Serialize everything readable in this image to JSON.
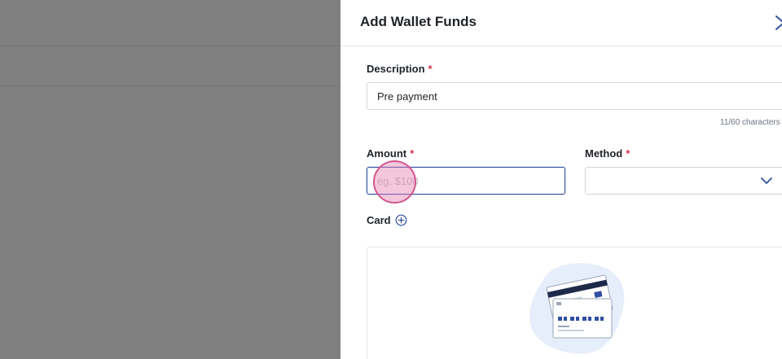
{
  "drawer": {
    "title": "Add Wallet Funds"
  },
  "form": {
    "description": {
      "label": "Description",
      "required_mark": "*",
      "value": "Pre payment",
      "char_count": "11/60 characters"
    },
    "amount": {
      "label": "Amount",
      "required_mark": "*",
      "placeholder": "eg. $100",
      "value": ""
    },
    "method": {
      "label": "Method",
      "required_mark": "*",
      "selected": ""
    },
    "card": {
      "label": "Card"
    }
  },
  "icons": {
    "close": "close-icon",
    "chevron": "chevron-down-icon",
    "add": "plus-circle-icon",
    "empty_state": "cards-illustration"
  },
  "colors": {
    "accent": "#2f4fa0",
    "required": "#d6334e",
    "overlay": "#808080"
  }
}
